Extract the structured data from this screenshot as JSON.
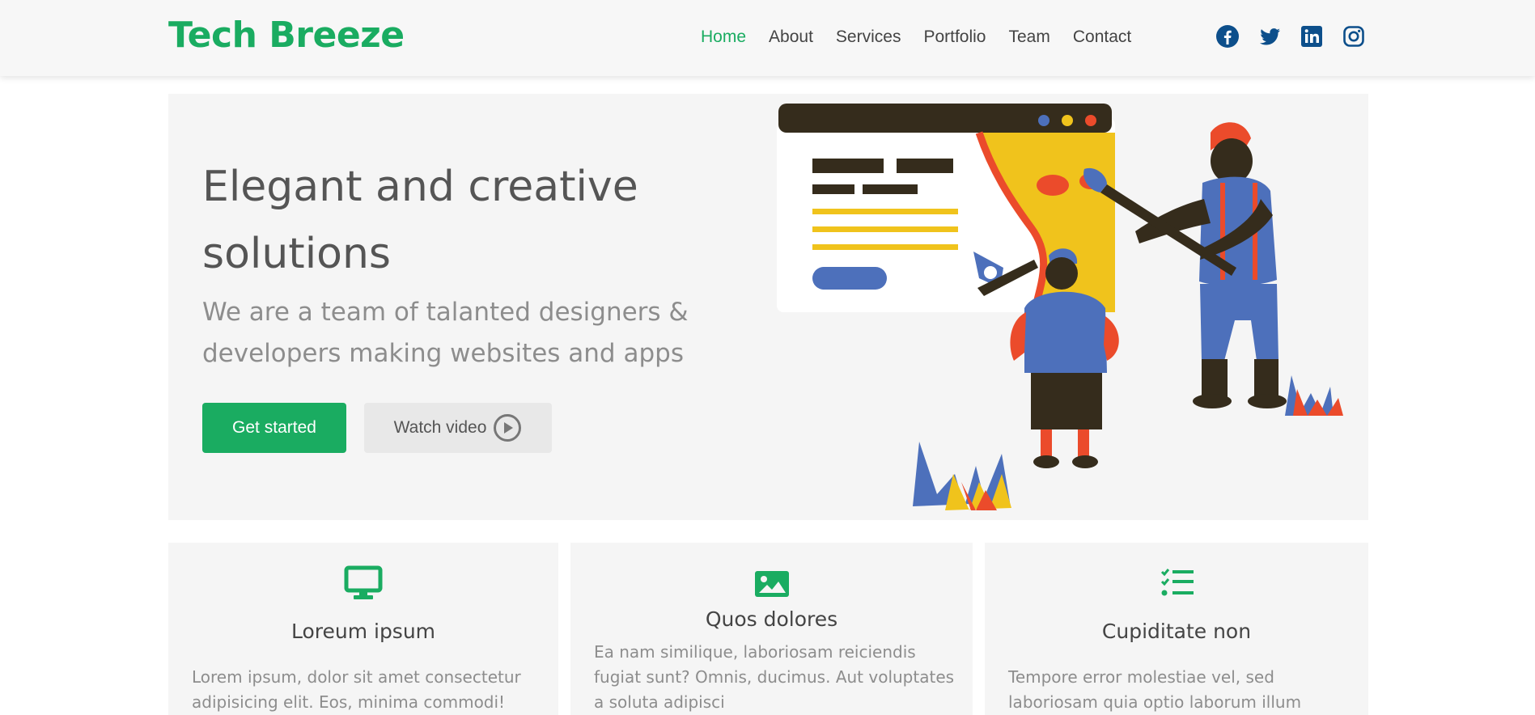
{
  "brand": {
    "name": "Tech Breeze",
    "accent_color": "#1aac61"
  },
  "nav": {
    "items": [
      {
        "label": "Home",
        "active": true
      },
      {
        "label": "About",
        "active": false
      },
      {
        "label": "Services",
        "active": false
      },
      {
        "label": "Portfolio",
        "active": false
      },
      {
        "label": "Team",
        "active": false
      },
      {
        "label": "Contact",
        "active": false
      }
    ]
  },
  "social": {
    "icons": [
      "facebook-icon",
      "twitter-icon",
      "linkedin-icon",
      "instagram-icon"
    ],
    "color": "#0d4f8b"
  },
  "hero": {
    "title": "Elegant and creative solutions",
    "subtitle": "We are a team of talanted designers & developers making websites and apps",
    "primary_button": "Get started",
    "secondary_button": "Watch video",
    "secondary_icon": "play-circle-icon",
    "illustration": "team-designers-illustration"
  },
  "features": [
    {
      "icon": "monitor-icon",
      "title": "Loreum ipsum",
      "text": "Lorem ipsum, dolor sit amet consectetur adipisicing elit. Eos, minima commodi!"
    },
    {
      "icon": "image-icon",
      "title": "Quos dolores",
      "text": "Ea nam similique, laboriosam reiciendis fugiat sunt? Omnis, ducimus. Aut voluptates a soluta adipisci"
    },
    {
      "icon": "checklist-icon",
      "title": "Cupiditate non",
      "text": "Tempore error molestiae vel, sed laboriosam quia optio laborum illum"
    }
  ]
}
